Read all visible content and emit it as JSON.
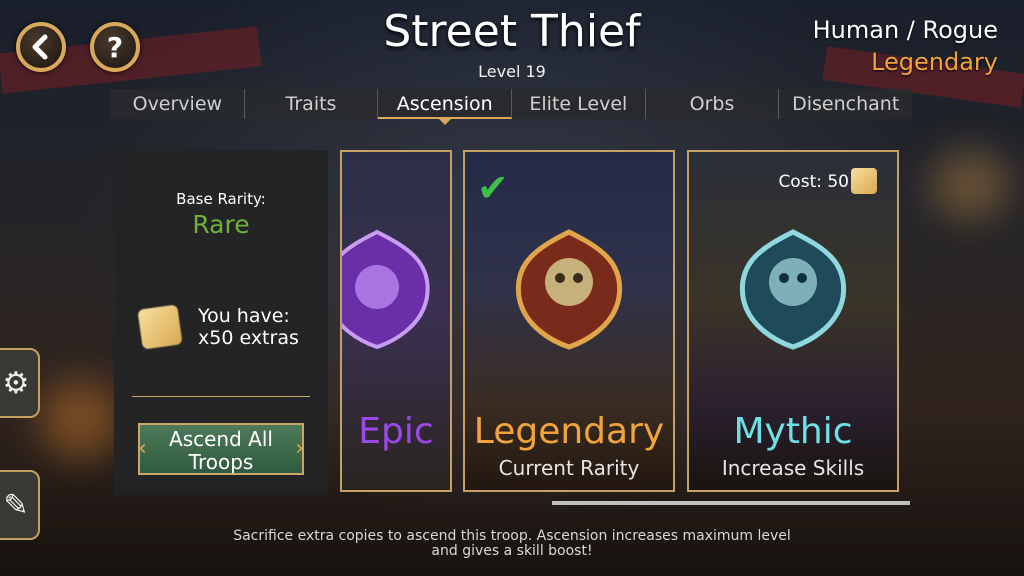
{
  "header": {
    "back_icon": "back-arrow-icon",
    "help_label": "?",
    "title": "Street Thief",
    "level": "Level 19",
    "race_class": "Human / Rogue",
    "rarity": "Legendary",
    "rarity_color": "#f0a43a"
  },
  "tabs": [
    {
      "label": "Overview",
      "active": false
    },
    {
      "label": "Traits",
      "active": false
    },
    {
      "label": "Ascension",
      "active": true
    },
    {
      "label": "Elite Level",
      "active": false
    },
    {
      "label": "Orbs",
      "active": false
    },
    {
      "label": "Disenchant",
      "active": false
    }
  ],
  "panel": {
    "base_rarity_label": "Base Rarity:",
    "base_rarity_value": "Rare",
    "base_rarity_color": "#6fb03a",
    "have_line1": "You have:",
    "have_line2": "x50 extras",
    "ascend_line1": "Ascend All",
    "ascend_line2": "Troops"
  },
  "cards": [
    {
      "rarity": "Epic",
      "subtitle": "",
      "color": "#9b48e8",
      "crest": "purple-crest-icon"
    },
    {
      "rarity": "Legendary",
      "subtitle": "Current Rarity",
      "color": "#f0a43a",
      "crest": "gold-crest-icon",
      "checked": true
    },
    {
      "rarity": "Mythic",
      "subtitle": "Increase Skills",
      "color": "#6fe0e6",
      "crest": "teal-crest-icon",
      "cost_label": "Cost: 50"
    }
  ],
  "footer": {
    "line1": "Sacrifice extra copies to ascend this troop. Ascension increases maximum level",
    "line2": "and gives a skill boost!"
  },
  "side": {
    "settings_icon": "gear-icon",
    "notes_icon": "notes-icon"
  }
}
